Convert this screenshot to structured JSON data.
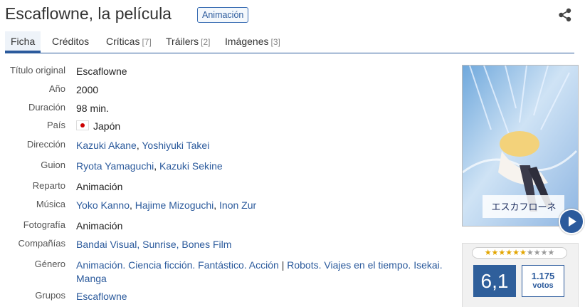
{
  "header": {
    "title": "Escaflowne, la película",
    "badge": "Animación"
  },
  "tabs": [
    {
      "label": "Ficha",
      "count": ""
    },
    {
      "label": "Créditos",
      "count": ""
    },
    {
      "label": "Críticas",
      "count": "[7]"
    },
    {
      "label": "Tráilers",
      "count": "[2]"
    },
    {
      "label": "Imágenes",
      "count": "[3]"
    }
  ],
  "info": {
    "original_title": {
      "label": "Título original",
      "value": "Escaflowne"
    },
    "year": {
      "label": "Año",
      "value": "2000"
    },
    "duration": {
      "label": "Duración",
      "value": "98 min."
    },
    "country": {
      "label": "País",
      "value": "Japón"
    },
    "direction": {
      "label": "Dirección",
      "people": [
        "Kazuki Akane",
        "Yoshiyuki Takei"
      ]
    },
    "script": {
      "label": "Guion",
      "people": [
        "Ryota Yamaguchi",
        "Kazuki Sekine"
      ]
    },
    "cast": {
      "label": "Reparto",
      "value": "Animación"
    },
    "music": {
      "label": "Música",
      "people": [
        "Yoko Kanno",
        "Hajime Mizoguchi",
        "Inon Zur"
      ]
    },
    "photography": {
      "label": "Fotografía",
      "value": "Animación"
    },
    "companies": {
      "label": "Compañías",
      "value": "Bandai Visual, Sunrise, Bones Film"
    },
    "genre": {
      "label": "Género",
      "primary": "Animación. Ciencia ficción. Fantástico. Acción",
      "separator": "|",
      "secondary": "Robots. Viajes en el tiempo. Isekai. Manga"
    },
    "groups": {
      "label": "Grupos",
      "value": "Escaflowne"
    }
  },
  "poster": {
    "caption": "エスカフローネ"
  },
  "rating": {
    "score": "6,1",
    "stars_filled": 6,
    "stars_total": 10,
    "votes": "1.175",
    "votes_label": "votos"
  },
  "colors": {
    "accent": "#2b5a9c",
    "score_bg": "#2f5f9b",
    "star": "#e2a500"
  }
}
